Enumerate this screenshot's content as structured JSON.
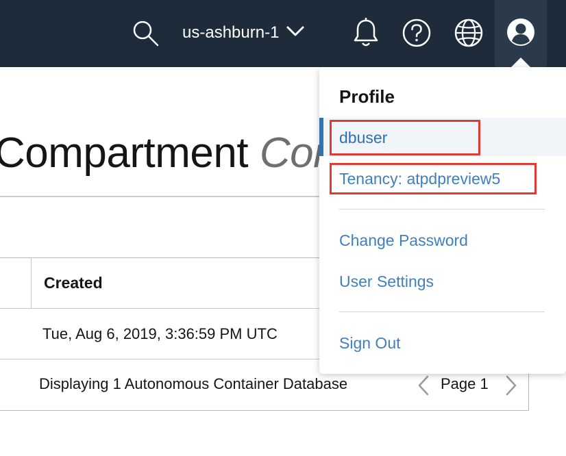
{
  "header": {
    "region": "us-ashburn-1",
    "icons": {
      "search": "search-icon",
      "region_chevron": "chevron-down-icon",
      "notifications": "bell-icon",
      "help": "help-icon",
      "language": "globe-icon",
      "profile": "user-icon"
    }
  },
  "page": {
    "title_normal": "Compartment ",
    "title_italic": "Con"
  },
  "table": {
    "columns": [
      "Created"
    ],
    "rows": [
      {
        "created": "Tue, Aug 6, 2019, 3:36:59 PM UTC"
      }
    ],
    "footer_text": "Displaying 1 Autonomous Container Database",
    "page_label": "Page 1"
  },
  "profile_menu": {
    "heading": "Profile",
    "user": "dbuser",
    "tenancy": "Tenancy: atpdpreview5",
    "change_password": "Change Password",
    "user_settings": "User Settings",
    "sign_out": "Sign Out"
  },
  "colors": {
    "topbar": "#1d2b3a",
    "link": "#3f7fbf",
    "active_indicator": "#3173b5",
    "highlight_box": "#e03a33"
  }
}
